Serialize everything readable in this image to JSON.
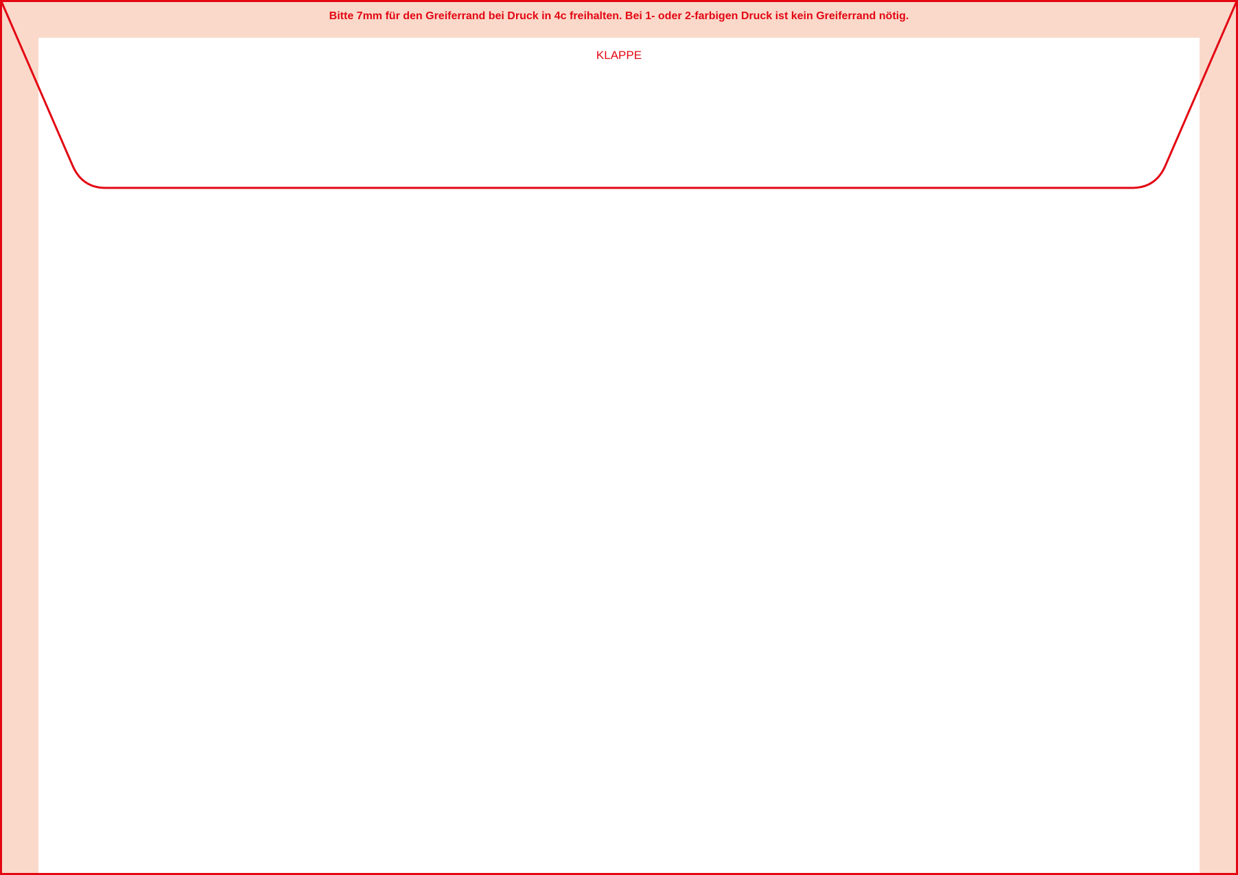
{
  "template": {
    "gripper_notice": "Bitte 7mm für den Greiferrand bei Druck in 4c freihalten. Bei 1- oder 2-farbigen Druck ist kein Greiferrand nötig.",
    "flap_label": "KLAPPE"
  },
  "colors": {
    "cut_line": "#e30613",
    "gripper_margin": "#fad9ca",
    "print_area": "#ffffff"
  }
}
